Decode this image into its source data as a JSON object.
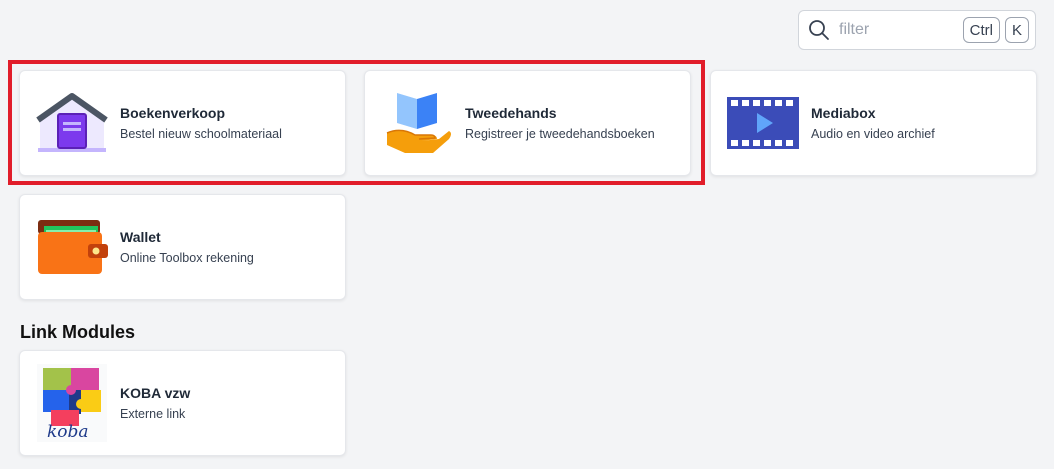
{
  "filter": {
    "placeholder": "filter",
    "key1": "Ctrl",
    "key2": "K"
  },
  "modules": [
    {
      "title": "Boekenverkoop",
      "subtitle": "Bestel nieuw schoolmateriaal",
      "icon": "school-house-book-icon"
    },
    {
      "title": "Tweedehands",
      "subtitle": "Registreer je tweedehandsboeken",
      "icon": "hand-book-icon"
    },
    {
      "title": "Mediabox",
      "subtitle": "Audio en video archief",
      "icon": "film-play-icon"
    },
    {
      "title": "Wallet",
      "subtitle": "Online Toolbox rekening",
      "icon": "wallet-icon"
    }
  ],
  "link_section": {
    "title": "Link Modules",
    "items": [
      {
        "title": "KOBA vzw",
        "subtitle": "Externe link",
        "icon": "koba-logo",
        "logo_text": "koba"
      }
    ]
  },
  "colors": {
    "highlight": "#e11d2a",
    "background": "#f3f4f6"
  }
}
